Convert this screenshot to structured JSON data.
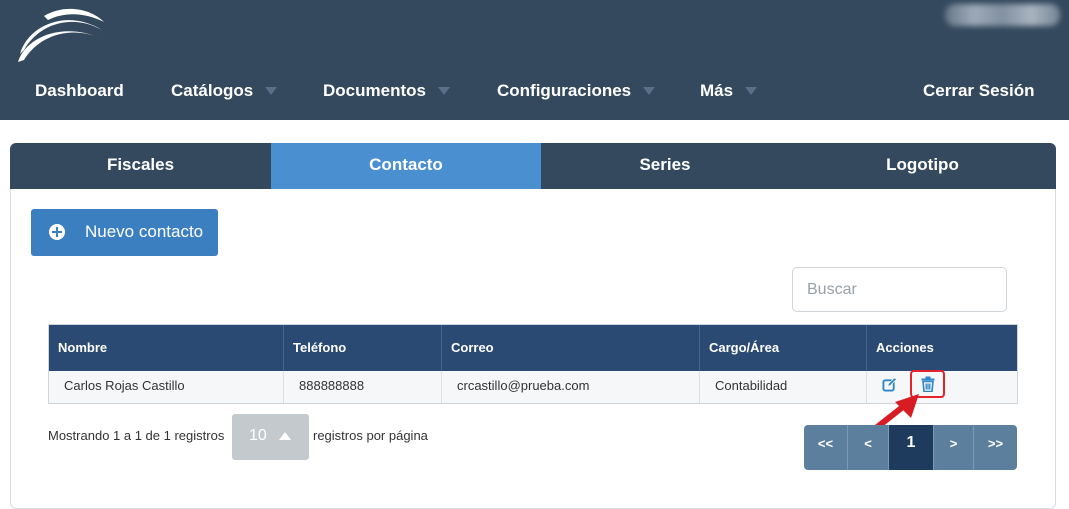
{
  "header": {
    "nav": [
      {
        "label": "Dashboard",
        "dropdown": false
      },
      {
        "label": "Catálogos",
        "dropdown": true
      },
      {
        "label": "Documentos",
        "dropdown": true
      },
      {
        "label": "Configuraciones",
        "dropdown": true
      },
      {
        "label": "Más",
        "dropdown": true
      }
    ],
    "logout_label": "Cerrar Sesión",
    "logo_icon": "swoosh-logo"
  },
  "tabs": [
    {
      "label": "Fiscales",
      "active": false
    },
    {
      "label": "Contacto",
      "active": true
    },
    {
      "label": "Series",
      "active": false
    },
    {
      "label": "Logotipo",
      "active": false
    }
  ],
  "toolbar": {
    "new_contact_label": "Nuevo contacto",
    "new_contact_icon": "plus-circle-icon"
  },
  "search": {
    "placeholder": "Buscar",
    "value": ""
  },
  "table": {
    "columns": [
      "Nombre",
      "Teléfono",
      "Correo",
      "Cargo/Área",
      "Acciones"
    ],
    "rows": [
      [
        "Carlos Rojas Castillo",
        "888888888",
        "crcastillo@prueba.com",
        "Contabilidad"
      ]
    ],
    "action_icons": [
      "edit-icon",
      "trash-icon"
    ]
  },
  "footer": {
    "showing_text": "Mostrando 1 a 1 de 1 registros",
    "page_size": "10",
    "per_page_text": "registros por página"
  },
  "pagination": {
    "first": "<<",
    "prev": "<",
    "current": "1",
    "next": ">",
    "last": ">>"
  },
  "colors": {
    "navbar": "#34495e",
    "tab_active": "#4a8fcf",
    "primary_button": "#3b7fc0",
    "table_header": "#2a4a73",
    "pager": "#5d7f9e",
    "pager_active": "#1e3a5c",
    "highlight": "#e5232a"
  }
}
